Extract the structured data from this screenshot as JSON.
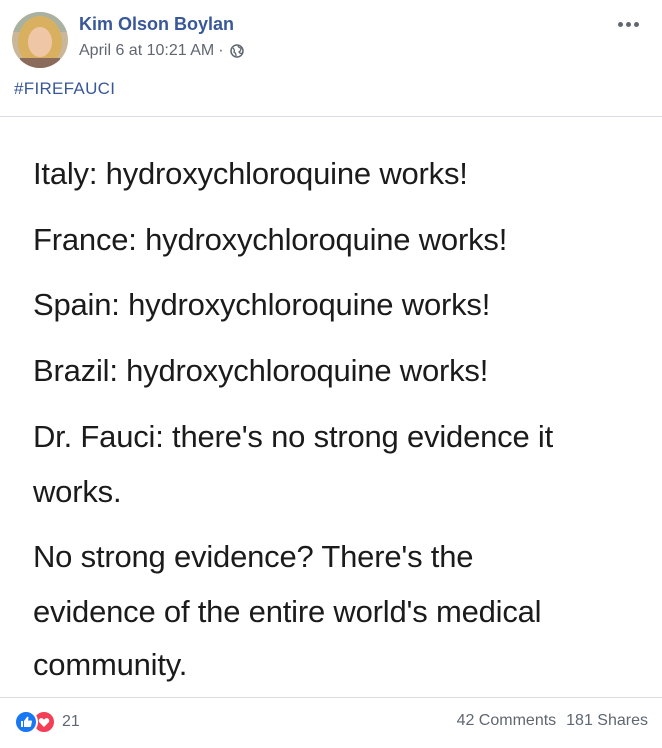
{
  "post": {
    "author": "Kim Olson Boylan",
    "timestamp": "April 6 at 10:21 AM",
    "separator": "·",
    "privacy_icon": "globe-icon",
    "hashtag": "#FIREFAUCI",
    "more_icon": "more-options-icon"
  },
  "image_text": {
    "lines": [
      "Italy: hydroxychloroquine works!",
      "France: hydroxychloroquine works!",
      "Spain: hydroxychloroquine works!",
      "Brazil: hydroxychloroquine works!",
      "Dr. Fauci: there's no strong evidence it",
      "works.",
      "No strong evidence? There's the",
      "evidence of the entire world's medical",
      "community."
    ]
  },
  "footer": {
    "reaction_icons": [
      "like-icon",
      "love-icon"
    ],
    "reaction_count": "21",
    "comments": "42 Comments",
    "shares": "181 Shares"
  },
  "colors": {
    "link": "#385898",
    "meta": "#616770",
    "like": "#1877f2",
    "love": "#f33e58"
  }
}
